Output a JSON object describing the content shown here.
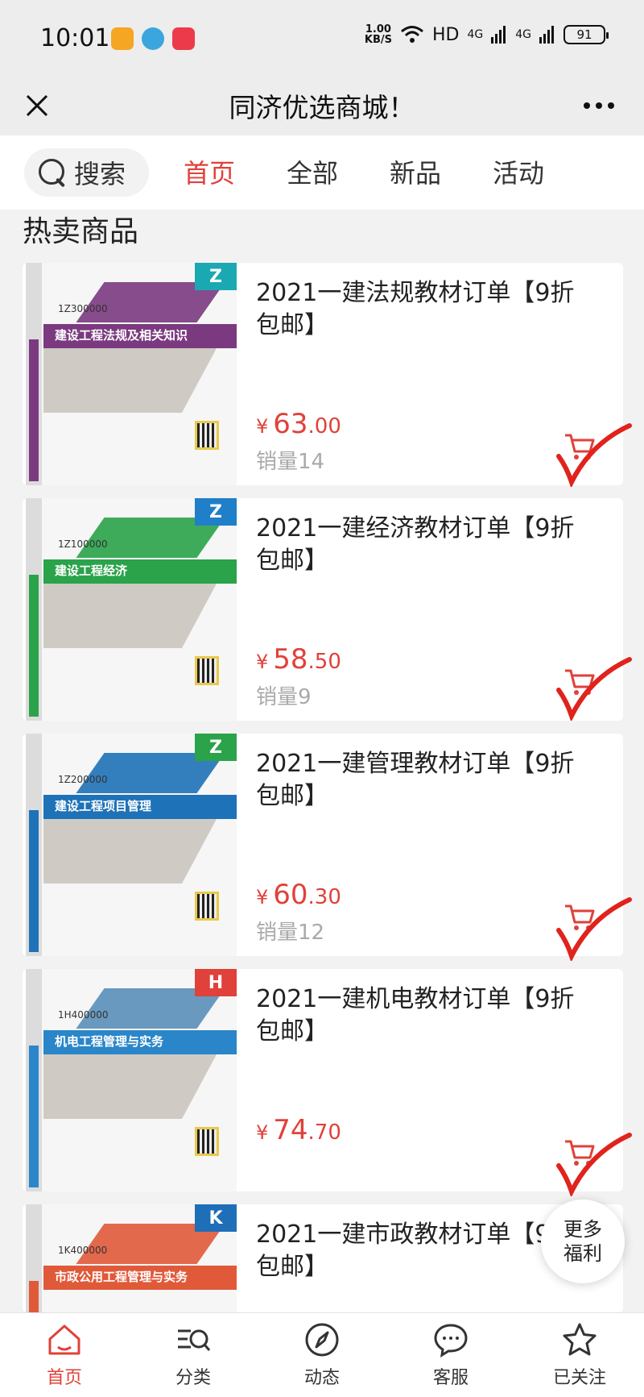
{
  "status_bar": {
    "time": "10:01",
    "speed_value": "1.00",
    "speed_unit": "KB/S",
    "network": "HD",
    "signal_1": "4G",
    "signal_2": "4G",
    "battery": "91",
    "app_icons": [
      "weibo-icon",
      "browser-icon",
      "xiaohongshu-icon"
    ]
  },
  "header": {
    "title": "同济优选商城！",
    "close_icon": "close-icon",
    "more_icon": "more-icon"
  },
  "nav": {
    "search_label": "搜索",
    "tabs": [
      "首页",
      "全部",
      "新品",
      "活动"
    ],
    "active_tab": 0
  },
  "section": {
    "title": "热卖商品"
  },
  "products": [
    {
      "name": "2021一建法规教材订单【9折包邮】",
      "price_int": "63",
      "price_dec": ".00",
      "sales": "销量14",
      "cover_code": "1Z300000",
      "cover_title": "建设工程法规及相关知识",
      "cover_letter": "Z",
      "cover_color": "#7b3a7f",
      "letter_color": "#1aa9b3"
    },
    {
      "name": "2021一建经济教材订单【9折包邮】",
      "price_int": "58",
      "price_dec": ".50",
      "sales": "销量9",
      "cover_code": "1Z100000",
      "cover_title": "建设工程经济",
      "cover_letter": "Z",
      "cover_color": "#2aa34a",
      "letter_color": "#1f7fc8"
    },
    {
      "name": "2021一建管理教材订单【9折包邮】",
      "price_int": "60",
      "price_dec": ".30",
      "sales": "销量12",
      "cover_code": "1Z200000",
      "cover_title": "建设工程项目管理",
      "cover_letter": "Z",
      "cover_color": "#1e72b8",
      "letter_color": "#2aa34a"
    },
    {
      "name": "2021一建机电教材订单【9折包邮】",
      "price_int": "74",
      "price_dec": ".70",
      "sales": "",
      "cover_code": "1H400000",
      "cover_title": "机电工程管理与实务",
      "cover_letter": "H",
      "cover_color": "#2a86c8",
      "letter_color": "#e0413a"
    },
    {
      "name": "2021一建市政教材订单【9折包邮】",
      "price_int": "",
      "price_dec": "",
      "sales": "",
      "cover_code": "1K400000",
      "cover_title": "市政公用工程管理与实务",
      "cover_letter": "K",
      "cover_color": "#e05a3a",
      "letter_color": "#1f6fb8"
    }
  ],
  "float_button": {
    "line1": "更多",
    "line2": "福利"
  },
  "bottom_nav": [
    {
      "label": "首页",
      "icon": "home-icon",
      "active": true
    },
    {
      "label": "分类",
      "icon": "category-icon",
      "active": false
    },
    {
      "label": "动态",
      "icon": "compass-icon",
      "active": false
    },
    {
      "label": "客服",
      "icon": "chat-icon",
      "active": false
    },
    {
      "label": "已关注",
      "icon": "star-icon",
      "active": false
    }
  ],
  "colors": {
    "accent": "#e0413a",
    "check_mark": "#e0231c",
    "background": "#f2f2f2"
  }
}
